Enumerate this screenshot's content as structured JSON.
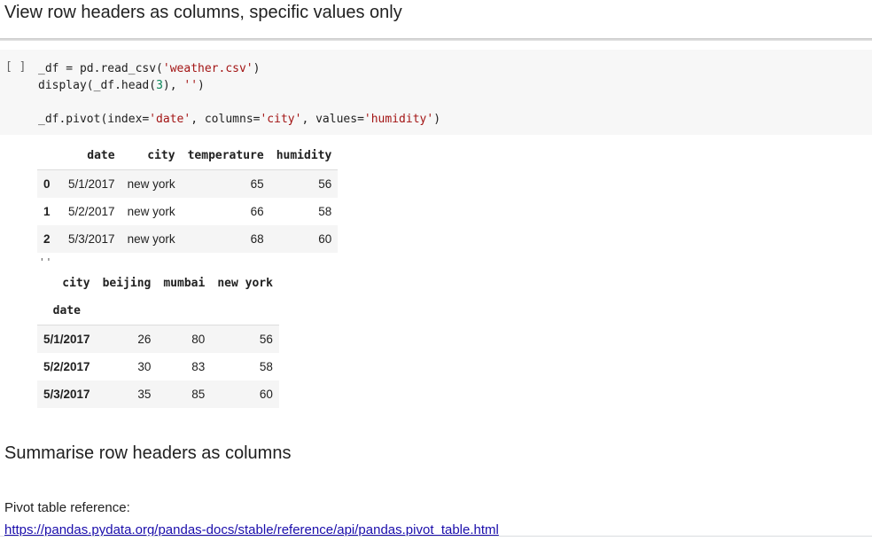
{
  "heading1": "View row headers as columns, specific values only",
  "cell": {
    "run_label": "[ ]",
    "code_lines": [
      "_df = pd.read_csv('weather.csv')",
      "display(_df.head(3), '')",
      "",
      "_df.pivot(index='date', columns='city', values='humidity')"
    ]
  },
  "output1": {
    "columns": [
      "",
      "date",
      "city",
      "temperature",
      "humidity"
    ],
    "rows": [
      {
        "index": "0",
        "date": "5/1/2017",
        "city": "new york",
        "temperature": "65",
        "humidity": "56"
      },
      {
        "index": "1",
        "date": "5/2/2017",
        "city": "new york",
        "temperature": "66",
        "humidity": "58"
      },
      {
        "index": "2",
        "date": "5/3/2017",
        "city": "new york",
        "temperature": "68",
        "humidity": "60"
      }
    ]
  },
  "quote_output": "''",
  "output2": {
    "columns_name": "city",
    "columns": [
      "beijing",
      "mumbai",
      "new york"
    ],
    "index_name": "date",
    "rows": [
      {
        "index": "5/1/2017",
        "beijing": "26",
        "mumbai": "80",
        "new_york": "56"
      },
      {
        "index": "5/2/2017",
        "beijing": "30",
        "mumbai": "83",
        "new_york": "58"
      },
      {
        "index": "5/3/2017",
        "beijing": "35",
        "mumbai": "85",
        "new_york": "60"
      }
    ]
  },
  "heading2": "Summarise row headers as columns",
  "reference_label": "Pivot table reference:",
  "reference_link": "https://pandas.pydata.org/pandas-docs/stable/reference/api/pandas.pivot_table.html"
}
